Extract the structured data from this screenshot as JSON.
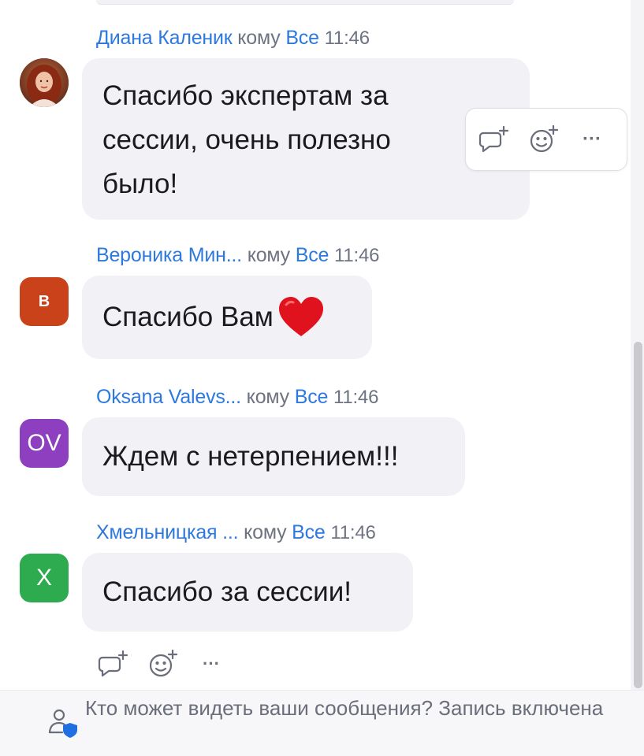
{
  "messages": [
    {
      "sender": "Диана Каленик",
      "to_label": "кому",
      "recipient": "Все",
      "time": "11:46",
      "avatar": {
        "type": "photo"
      },
      "lines": [
        "Спасибо экспертам за",
        "сессии, очень полезно",
        "было!"
      ]
    },
    {
      "sender": "Вероника Мин...",
      "to_label": "кому",
      "recipient": "Все",
      "time": "11:46",
      "avatar": {
        "type": "initials",
        "text": "В",
        "color": "#c9421a"
      },
      "lines": [
        "Спасибо Вам"
      ],
      "emoji": "heart"
    },
    {
      "sender": "Oksana Valevs...",
      "to_label": "кому",
      "recipient": "Все",
      "time": "11:46",
      "avatar": {
        "type": "initials",
        "text": "OV",
        "color": "#8e3fbf"
      },
      "lines": [
        "Ждем с нетерпением!!!"
      ]
    },
    {
      "sender": "Хмельницкая ...",
      "to_label": "кому",
      "recipient": "Все",
      "time": "11:46",
      "avatar": {
        "type": "initials",
        "text": "X",
        "color": "#2eaa4f"
      },
      "lines": [
        "Спасибо за сессии!"
      ]
    }
  ],
  "hover_toolbar": {
    "icons": [
      "reply-thread-icon",
      "add-reaction-icon",
      "more-icon"
    ],
    "more_label": "···"
  },
  "bottom_actions": {
    "icons": [
      "reply-thread-icon",
      "add-reaction-icon",
      "more-icon"
    ],
    "more_label": "···"
  },
  "footer": {
    "text": "Кто может видеть ваши сообщения? Запись включена",
    "icon": "person-shield-icon"
  },
  "colors": {
    "sender_blue": "#2d79de",
    "bubble_bg": "#f1f1f6",
    "meta_gray": "#6e7381"
  }
}
